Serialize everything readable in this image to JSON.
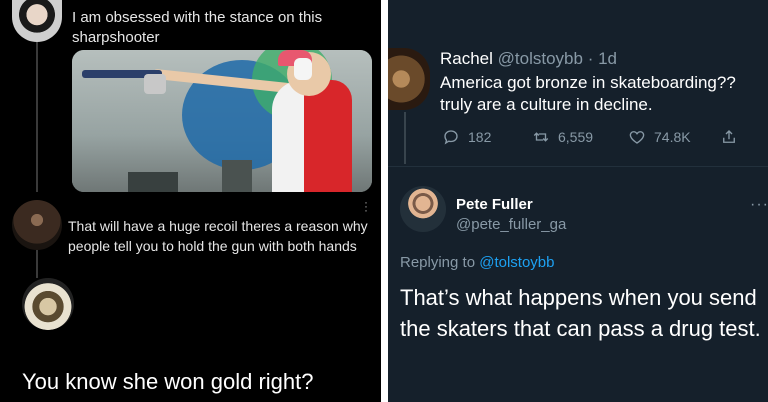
{
  "left_thread": {
    "posts": [
      {
        "text": "I am obsessed with the stance on this sharpshooter",
        "avatar_icon": "profile-avatar-icon"
      },
      {
        "text": "That will have a huge recoil theres a reason why people tell you to hold the gun with both hands",
        "avatar_icon": "profile-avatar-icon"
      },
      {
        "text": "You know she won gold right?",
        "avatar_icon": "profile-avatar-icon"
      }
    ]
  },
  "right_thread": {
    "tweet": {
      "name": "Rachel",
      "handle": "@tolstoybb",
      "time": "· 1d",
      "text": "America got bronze in skateboarding?? truly are a culture in decline.",
      "actions": {
        "reply_count": "182",
        "retweet_count": "6,559",
        "like_count": "74.8K"
      }
    },
    "reply": {
      "name": "Pete Fuller",
      "handle": "@pete_fuller_ga",
      "replying_prefix": "Replying to",
      "replying_to": "@tolstoybb",
      "text": "That’s what happens when you send the skaters that can pass a drug test."
    }
  },
  "colors": {
    "left_bg": "#000000",
    "right_bg": "#15202b",
    "muted": "#8899a6",
    "accent": "#1da1f2"
  }
}
